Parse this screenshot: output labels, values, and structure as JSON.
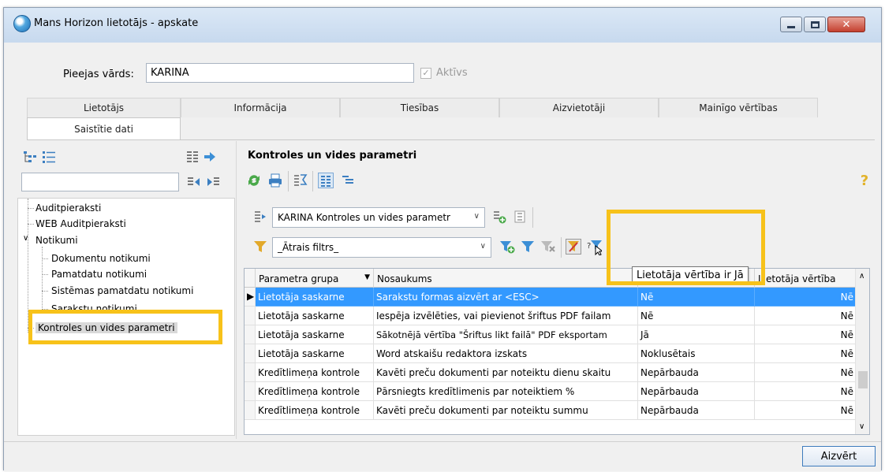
{
  "window": {
    "title": "Mans Horizon lietotājs - apskate"
  },
  "form": {
    "login_label": "Pieejas vārds:",
    "login_value": "KARINA",
    "active_label": "Aktīvs",
    "active_checked": true
  },
  "tabs": [
    {
      "label": "Lietotājs"
    },
    {
      "label": "Informācija"
    },
    {
      "label": "Tiesības"
    },
    {
      "label": "Aizvietotāji"
    },
    {
      "label": "Mainīgo vērtības"
    },
    {
      "label": "Saistītie dati",
      "active": true
    }
  ],
  "tree": {
    "items": [
      {
        "label": "Auditpieraksti"
      },
      {
        "label": "WEB Auditpieraksti"
      },
      {
        "label": "Notikumi",
        "expanded": true
      },
      {
        "label": "Dokumentu notikumi"
      },
      {
        "label": "Pamatdatu notikumi"
      },
      {
        "label": "Sistēmas pamatdatu notikumi"
      },
      {
        "label": "Sarakstu notikumi"
      },
      {
        "label": "Kontroles un vides parametri",
        "selected": true
      }
    ]
  },
  "main": {
    "title": "Kontroles un vides parametri",
    "profile_value": "KARINA Kontroles un vides parametr",
    "filter_value": "_Ātrais filtrs_",
    "tooltip": "Lietotāja vērtība ir Jā"
  },
  "grid": {
    "columns": [
      "Parametra grupa",
      "Nosaukums",
      "",
      "Lietotāja vērtība"
    ],
    "rows": [
      {
        "group": "Lietotāja saskarne",
        "name": "Sarakstu formas aizvērt ar <ESC>",
        "value": "Nē",
        "user_value": "Nē",
        "selected": true
      },
      {
        "group": "Lietotāja saskarne",
        "name": "Iespēja izvēlēties, vai pievienot šriftus PDF failam",
        "value": "Nē",
        "user_value": "Nē"
      },
      {
        "group": "Lietotāja saskarne",
        "name": "Sākotnējā vērtība \"Šriftus likt failā\" PDF eksportam",
        "value": "Jā",
        "user_value": "Nē"
      },
      {
        "group": "Lietotāja saskarne",
        "name": "Word atskaišu redaktora izskats",
        "value": "Noklusētais",
        "user_value": "Nē"
      },
      {
        "group": "Kredītlimeņa kontrole",
        "name": "Kavēti preču dokumenti par noteiktu dienu skaitu",
        "value": "Nepārbauda",
        "user_value": "Nē"
      },
      {
        "group": "Kredītlimeņa kontrole",
        "name": "Pārsniegts kredītlimenis par noteiktiem %",
        "value": "Nepārbauda",
        "user_value": "Nē"
      },
      {
        "group": "Kredītlimeņa kontrole",
        "name": "Kavēti preču dokumenti par noteiktu summu",
        "value": "Nepārbauda",
        "user_value": "Nē"
      }
    ]
  },
  "footer": {
    "close_label": "Aizvērt"
  },
  "colors": {
    "selection": "#3399ff",
    "highlight": "#f7c21a",
    "accent": "#3d7bbd"
  },
  "icons": [
    "app-icon",
    "refresh-icon",
    "print-icon",
    "sum-icon",
    "columns-icon",
    "tree-toggle-icon",
    "help-icon",
    "filter-icon",
    "add-filter-icon",
    "user-filter-icon"
  ]
}
